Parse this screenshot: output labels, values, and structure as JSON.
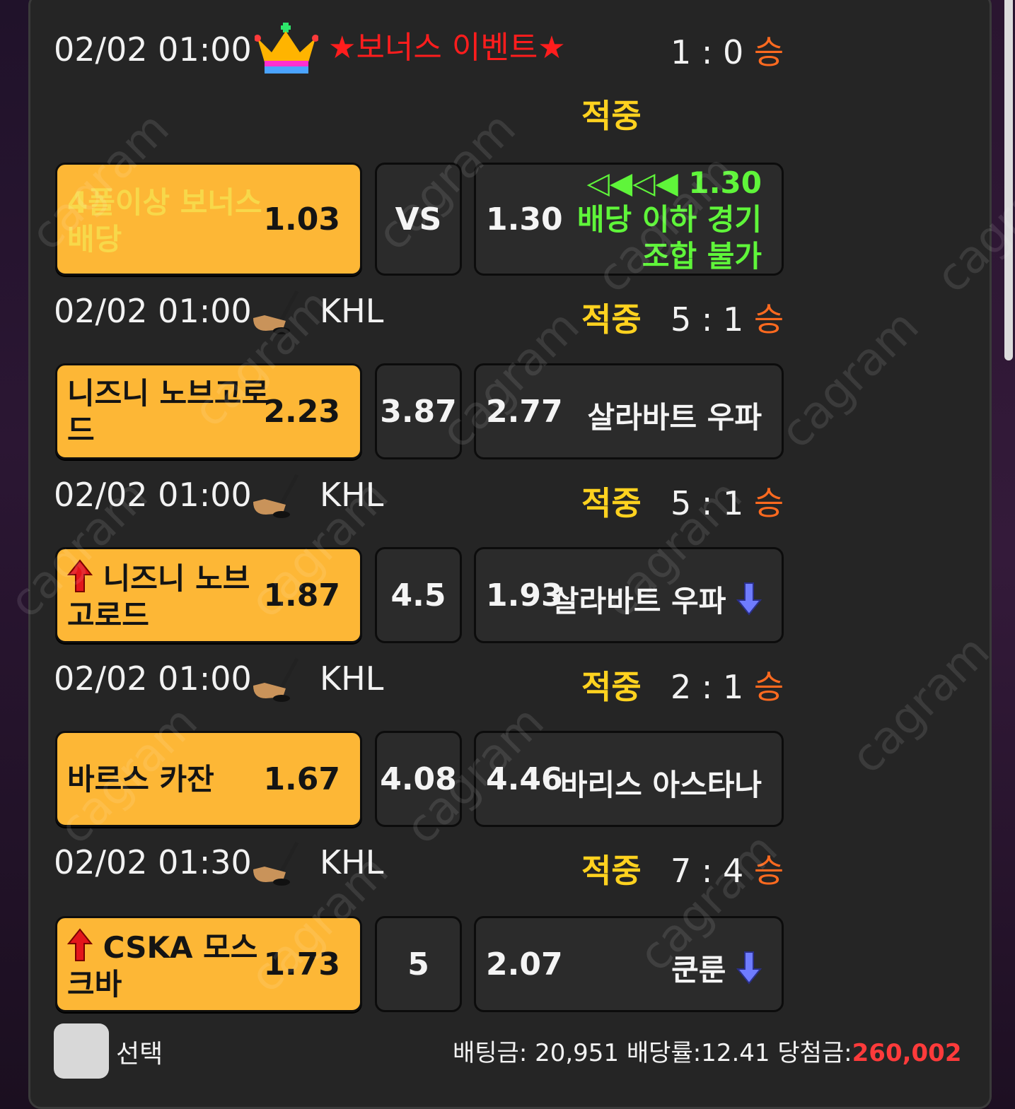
{
  "hit_label": "적중",
  "win_label": "승",
  "bonus": {
    "time": "02/02 01:00",
    "title": "★보너스 이벤트★",
    "score": "1 : 0",
    "home_name": "4폴이상 보너스 배당",
    "home_odds": "1.03",
    "mid": "VS",
    "away_odds": "1.30",
    "note_line1": "◁◀◁◀ 1.30",
    "note_line2": "배당 이하 경기",
    "note_line3": "조합 불가"
  },
  "games": [
    {
      "time": "02/02 01:00",
      "league": "KHL",
      "score": "5 : 1",
      "home": "니즈니 노브고로드",
      "home_odds": "2.23",
      "mid": "3.87",
      "away_odds": "2.77",
      "away": "살라바트 우파",
      "home_arrow": false,
      "away_arrow": false
    },
    {
      "time": "02/02 01:00",
      "league": "KHL",
      "score": "5 : 1",
      "home": "니즈니 노브고로드",
      "home_odds": "1.87",
      "mid": "4.5",
      "away_odds": "1.93",
      "away": "살라바트 우파",
      "home_arrow": true,
      "away_arrow": true
    },
    {
      "time": "02/02 01:00",
      "league": "KHL",
      "score": "2 : 1",
      "home": "바르스 카잔",
      "home_odds": "1.67",
      "mid": "4.08",
      "away_odds": "4.46",
      "away": "바리스 아스타나",
      "home_arrow": false,
      "away_arrow": false
    },
    {
      "time": "02/02 01:30",
      "league": "KHL",
      "score": "7 : 4",
      "home": "CSKA 모스크바",
      "home_odds": "1.73",
      "mid": "5",
      "away_odds": "2.07",
      "away": "쿤룬",
      "home_arrow": true,
      "away_arrow": true
    }
  ],
  "footer": {
    "select_label": "선택",
    "bet_label": "배팅금: 20,951",
    "rate_label": "배당률:12.41",
    "win_amount_label": "당첨금:",
    "win_amount": "260,002"
  },
  "icons": {
    "crown": "crown-icon",
    "hockey": "hockey-stick-icon",
    "up": "red-up-arrow-icon",
    "down": "blue-down-arrow-icon"
  },
  "colors": {
    "home_box": "#fdb736",
    "hit": "#ffd21f",
    "win": "#ff6a1f",
    "bonus_title": "#ff1d1d",
    "bonus_note": "#5ff53a",
    "win_amount": "#ff3b3b"
  },
  "watermark": "cagram"
}
